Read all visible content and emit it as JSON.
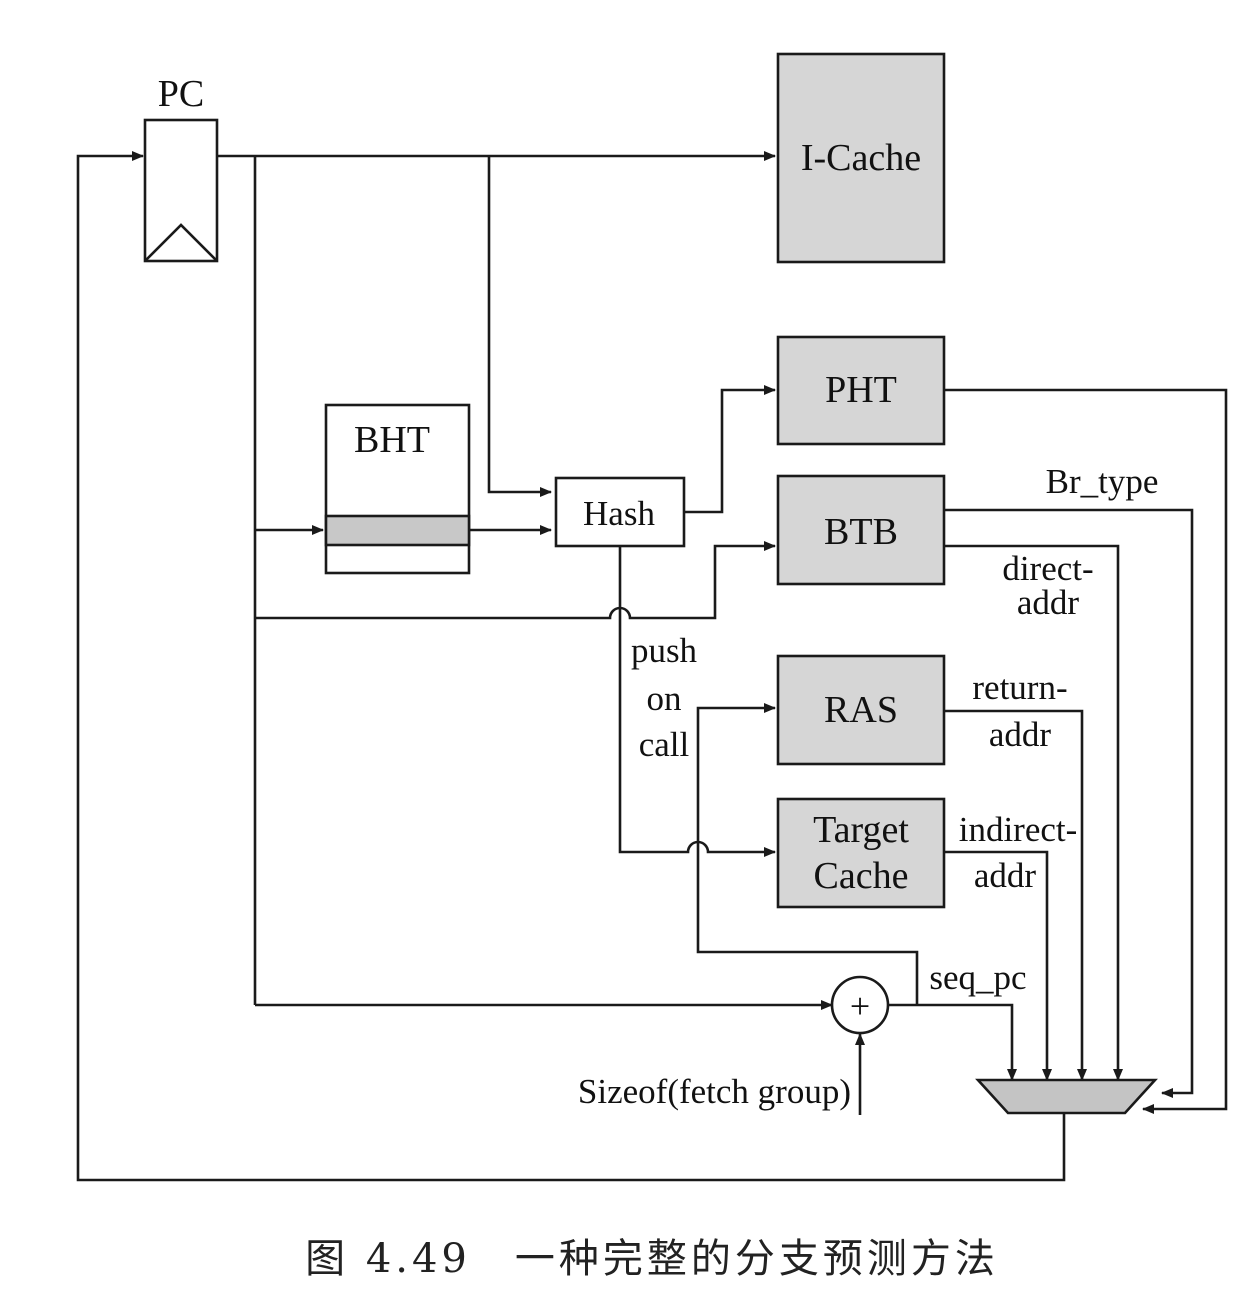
{
  "diagram": {
    "pc_label": "PC",
    "icache_label": "I-Cache",
    "pht_label": "PHT",
    "bht_label": "BHT",
    "hash_label": "Hash",
    "btb_label": "BTB",
    "ras_label": "RAS",
    "target_cache_label_line1": "Target",
    "target_cache_label_line2": "Cache",
    "adder_symbol": "+",
    "br_type_label": "Br_type",
    "direct_addr_line1": "direct-",
    "direct_addr_line2": "addr",
    "push_line1": "push",
    "push_line2": "on",
    "push_line3": "call",
    "return_addr_line1": "return-",
    "return_addr_line2": "addr",
    "indirect_addr_line1": "indirect-",
    "indirect_addr_line2": "addr",
    "seq_pc_label": "seq_pc",
    "sizeof_label": "Sizeof(fetch group)"
  },
  "caption": "图 4.49　一种完整的分支预测方法",
  "colors": {
    "block_fill": "#d6d6d6",
    "bht_row_fill": "#c8c8c8",
    "mux_fill": "#c4c4c4",
    "line": "#1a1a1a",
    "background": "#ffffff"
  }
}
